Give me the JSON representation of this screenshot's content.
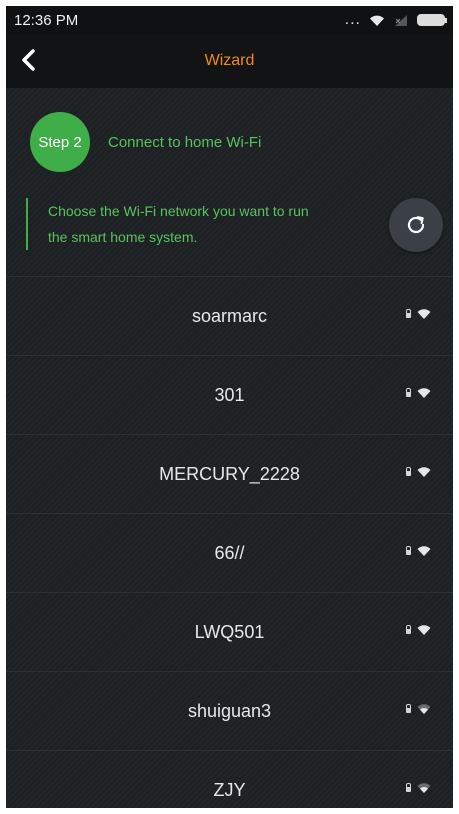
{
  "status": {
    "time": "12:36 PM",
    "dots": "..."
  },
  "nav": {
    "title": "Wizard"
  },
  "step": {
    "badge": "Step 2",
    "title": "Connect to home Wi-Fi"
  },
  "instruction": {
    "line1": "Choose the Wi-Fi network you want to run",
    "line2": "the smart home system."
  },
  "networks": [
    {
      "ssid": "soarmarc",
      "signal": "strong"
    },
    {
      "ssid": "301",
      "signal": "strong"
    },
    {
      "ssid": "MERCURY_2228",
      "signal": "strong"
    },
    {
      "ssid": "66//",
      "signal": "strong"
    },
    {
      "ssid": "LWQ501",
      "signal": "strong"
    },
    {
      "ssid": "shuiguan3",
      "signal": "medium"
    },
    {
      "ssid": "ZJY",
      "signal": "medium"
    }
  ],
  "colors": {
    "accent": "#3fae49",
    "title": "#f08a1c",
    "background": "#1e2124"
  },
  "icons": [
    "back-arrow-icon",
    "refresh-icon",
    "lock-icon",
    "wifi-icon"
  ]
}
